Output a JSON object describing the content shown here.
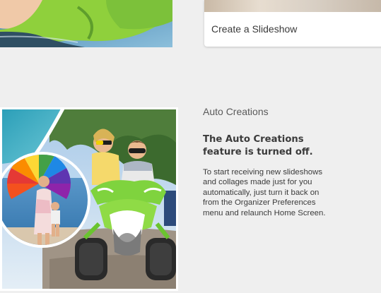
{
  "slideshow_card": {
    "label": "Create a Slideshow"
  },
  "auto_creations": {
    "title": "Auto Creations",
    "heading": "The Auto Creations feature is turned off.",
    "body": "To start receiving new slideshows and collages made just for you automatically, just turn it back on from the Organizer Preferences menu and relaunch Home Screen."
  },
  "colors": {
    "background": "#efefef",
    "card": "#ffffff",
    "text": "#3b3b3b"
  }
}
